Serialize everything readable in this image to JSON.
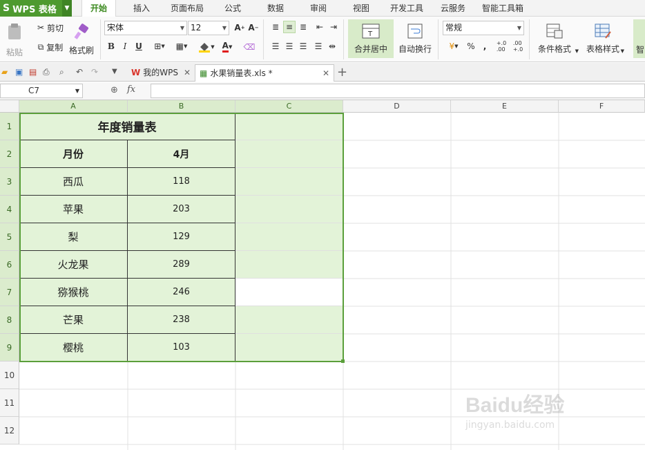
{
  "app": {
    "name": "WPS 表格"
  },
  "menu": {
    "tabs": [
      "开始",
      "插入",
      "页面布局",
      "公式",
      "数据",
      "审阅",
      "视图",
      "开发工具",
      "云服务",
      "智能工具箱"
    ],
    "active": "开始"
  },
  "ribbon": {
    "paste": "粘贴",
    "cut": "剪切",
    "copy": "复制",
    "format_painter": "格式刷",
    "font_name": "宋体",
    "font_size": "12",
    "merge_center": "合并居中",
    "wrap_text": "自动换行",
    "number_format": "常规",
    "percent": "%",
    "comma": "،",
    "conditional_format": "条件格式",
    "table_style": "表格样式",
    "smart": "智"
  },
  "doc_tabs": [
    {
      "label": "我的WPS",
      "active": false
    },
    {
      "label": "水果销量表.xls *",
      "active": true
    }
  ],
  "formula_bar": {
    "cell_ref": "C7",
    "fx": "fx",
    "value": ""
  },
  "columns": [
    "A",
    "B",
    "C",
    "D",
    "E",
    "F"
  ],
  "rows": [
    "1",
    "2",
    "3",
    "4",
    "5",
    "6",
    "7",
    "8",
    "9",
    "10",
    "11",
    "12"
  ],
  "sheet": {
    "title": "年度销量表",
    "header": [
      "月份",
      "4月"
    ],
    "data": [
      [
        "西瓜",
        "118"
      ],
      [
        "苹果",
        "203"
      ],
      [
        "梨",
        "129"
      ],
      [
        "火龙果",
        "289"
      ],
      [
        "猕猴桃",
        "246"
      ],
      [
        "芒果",
        "238"
      ],
      [
        "樱桃",
        "103"
      ]
    ]
  },
  "colors": {
    "accent": "#4e9a2f",
    "selection_fill": "#e3f3d8",
    "selection_border": "#5a9f3a"
  },
  "watermark": {
    "text": "Baidu经验",
    "url": "jingyan.baidu.com"
  }
}
